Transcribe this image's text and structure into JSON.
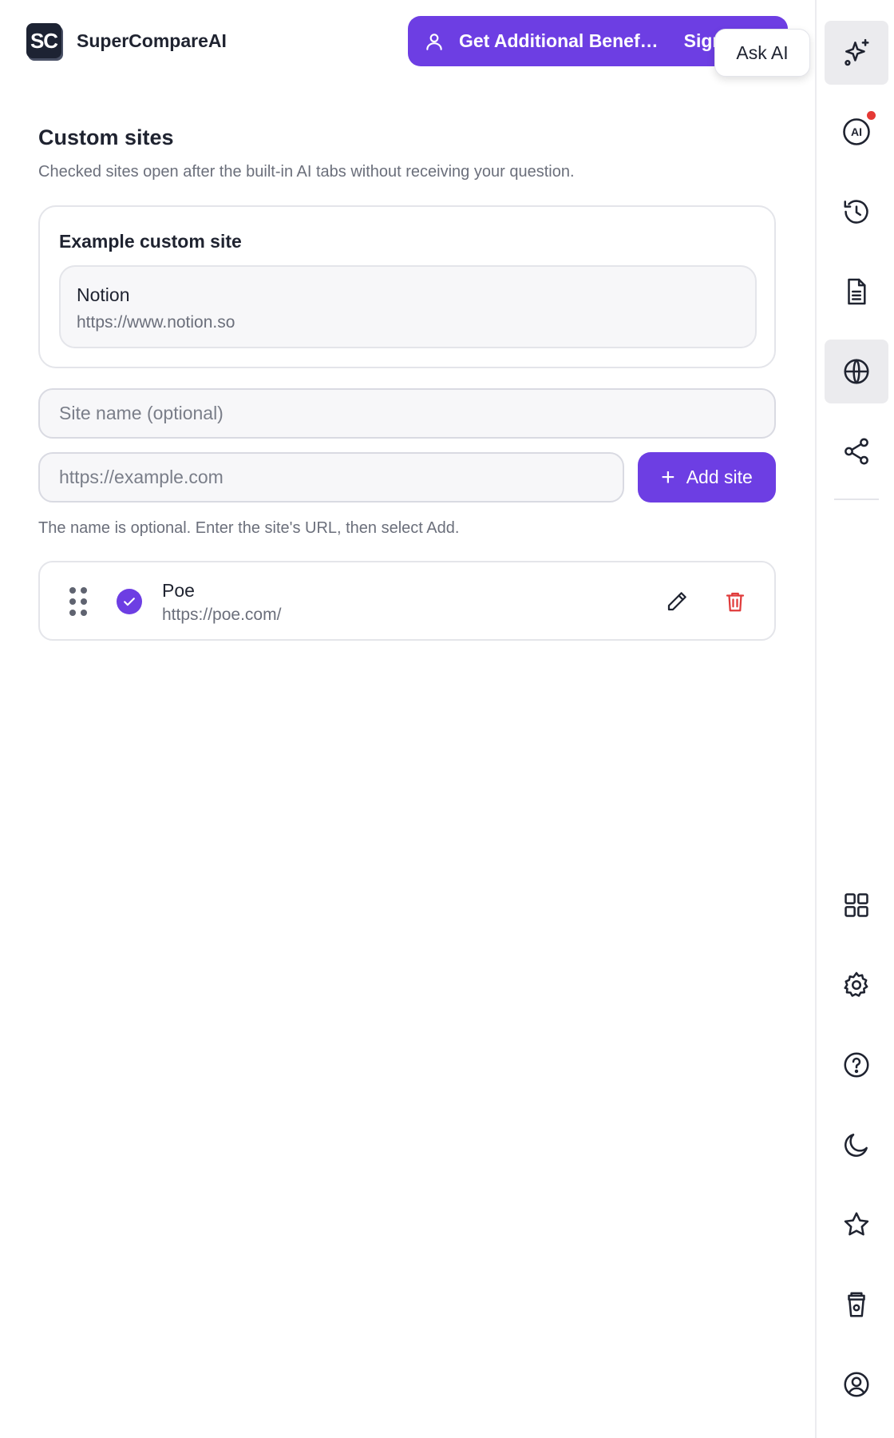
{
  "header": {
    "logo_text": "SC",
    "brand": "SuperCompareAI",
    "benefits_label": "Get Additional Benef…",
    "signin_partial": "Sign in",
    "tooltip": "Ask AI"
  },
  "section": {
    "title": "Custom sites",
    "description": "Checked sites open after the built-in AI tabs without receiving your question."
  },
  "example": {
    "title": "Example custom site",
    "name": "Notion",
    "url": "https://www.notion.so"
  },
  "form": {
    "name_placeholder": "Site name (optional)",
    "url_placeholder": "https://example.com",
    "add_label": "Add site",
    "hint": "The name is optional. Enter the site's URL, then select Add."
  },
  "sites": [
    {
      "name": "Poe",
      "url": "https://poe.com/",
      "checked": true
    }
  ],
  "rail": {
    "top_icons": [
      "sparkles-icon",
      "ai-icon",
      "history-icon",
      "document-icon",
      "globe-icon",
      "share-icon"
    ],
    "bottom_icons": [
      "grid-icon",
      "gear-icon",
      "help-icon",
      "moon-icon",
      "star-icon",
      "coffee-icon",
      "user-icon"
    ],
    "active": [
      "sparkles-icon",
      "globe-icon"
    ],
    "ai_label": "AI"
  },
  "colors": {
    "accent": "#6d3ee3",
    "danger": "#e03b3b",
    "muted_text": "#6b6f7b",
    "border": "#e4e5ea"
  }
}
